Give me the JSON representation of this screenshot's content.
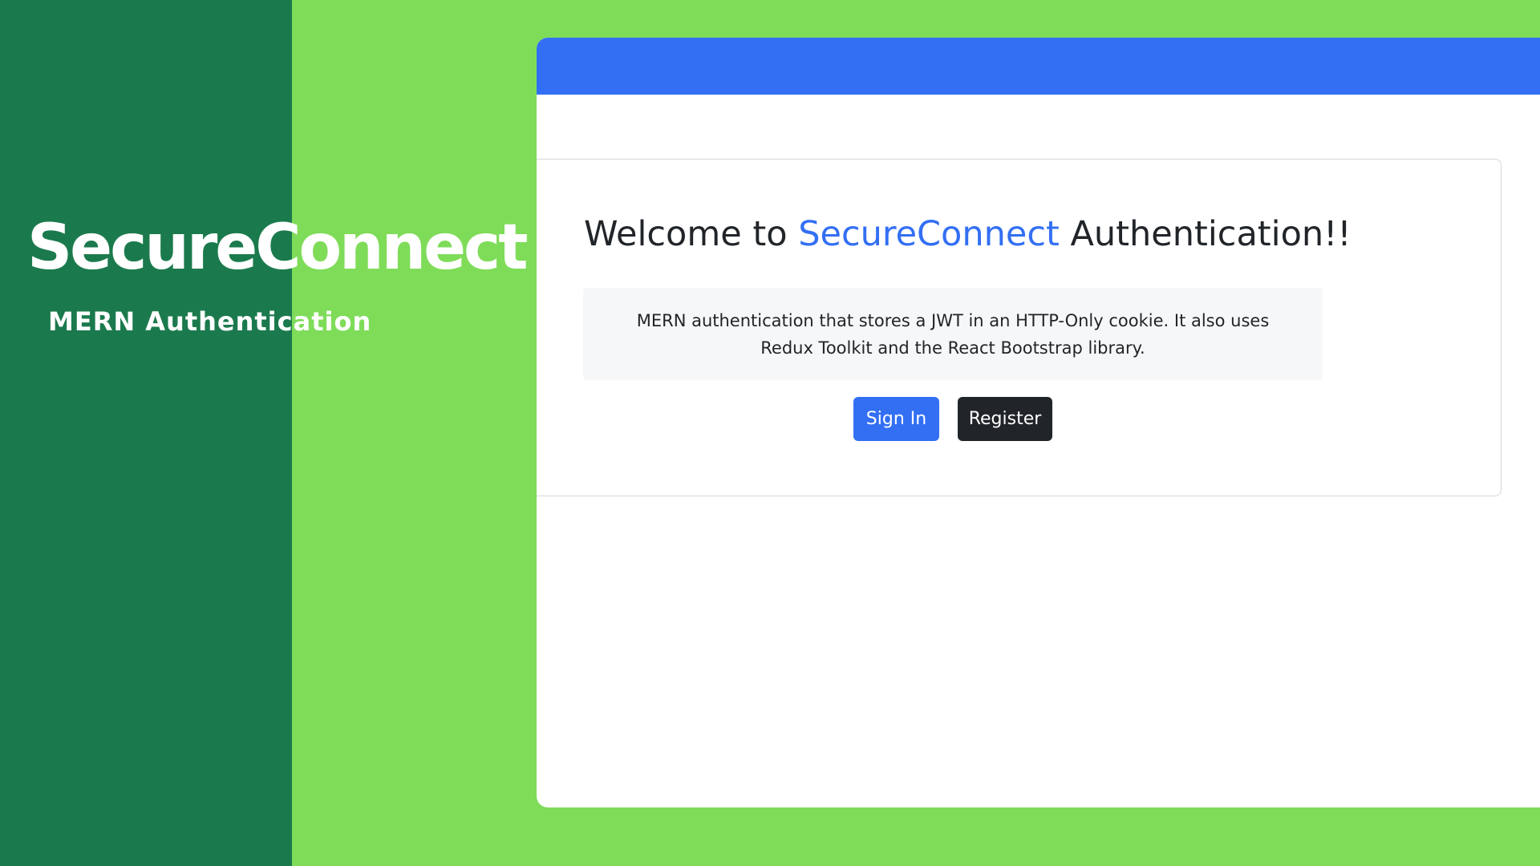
{
  "brand": {
    "title": "SecureConnect",
    "subtitle": "MERN Authentication"
  },
  "hero": {
    "heading_prefix": "Welcome to",
    "heading_brand": "SecureConnect",
    "heading_suffix": "Authentication!!",
    "description": "MERN authentication that stores a JWT in an HTTP-Only cookie. It also uses Redux Toolkit and the React Bootstrap library."
  },
  "buttons": {
    "sign_in": "Sign In",
    "register": "Register"
  },
  "colors": {
    "background_green": "#7fdc59",
    "dark_green": "#1b7a4d",
    "primary_blue": "#336ff3",
    "dark_button": "#212529"
  }
}
